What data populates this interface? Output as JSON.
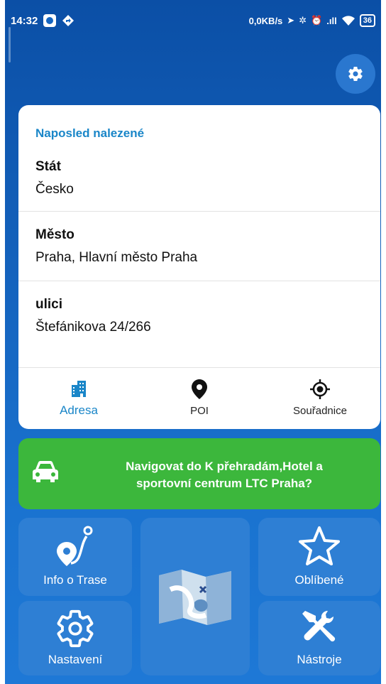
{
  "status_bar": {
    "time": "14:32",
    "net_speed": "0,0KB/s",
    "signal": ".ıll",
    "battery": "36"
  },
  "last_found": {
    "title": "Naposled nalezené",
    "fields": [
      {
        "label": "Stát",
        "value": "Česko"
      },
      {
        "label": "Město",
        "value": "Praha, Hlavní město Praha"
      },
      {
        "label": "ulici",
        "value": "Štefánikova 24/266"
      }
    ]
  },
  "tabs": [
    {
      "label": "Adresa",
      "icon": "building-icon",
      "active": true
    },
    {
      "label": "POI",
      "icon": "location-pin-icon",
      "active": false
    },
    {
      "label": "Souřadnice",
      "icon": "crosshair-icon",
      "active": false
    }
  ],
  "navigate": {
    "line1": "Navigovat do K přehradám,Hotel a",
    "line2": "sportovní centrum LTC Praha?",
    "icon": "car-icon"
  },
  "menu": {
    "info": "Info o Trase",
    "favorites": "Oblíbené",
    "settings": "Nastavení",
    "tools": "Nástroje",
    "map_icon": "map-icon"
  },
  "colors": {
    "background": "#1565c0",
    "accent": "#1a86c8",
    "navigate_green": "#3cb73c",
    "tile": "#2e7fd4"
  }
}
